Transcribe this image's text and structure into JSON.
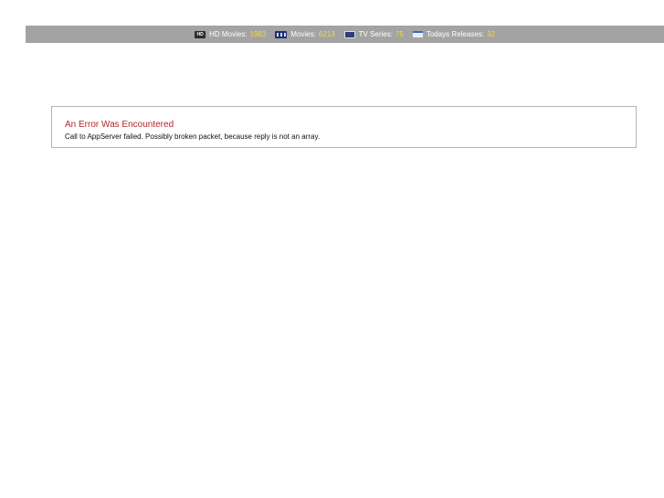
{
  "stats_bar": {
    "hd_movies": {
      "icon": "hd-icon",
      "label": "HD Movies:",
      "value": "1983"
    },
    "movies": {
      "icon": "film-icon",
      "label": "Movies:",
      "value": "6213"
    },
    "tv_series": {
      "icon": "tv-icon",
      "label": "TV Series:",
      "value": "75"
    },
    "todays_releases": {
      "icon": "calendar-icon",
      "label": "Todays Releases:",
      "value": "32"
    },
    "hd_badge_text": "HD"
  },
  "error": {
    "title": "An Error Was Encountered",
    "message": "Call to AppServer failed. Possibly broken packet, because reply is not an array."
  },
  "colors": {
    "bar_background": "#a3a3a3",
    "stat_value": "#f1dc3a",
    "error_title": "#b3272d",
    "error_border": "#b5b5b5"
  }
}
